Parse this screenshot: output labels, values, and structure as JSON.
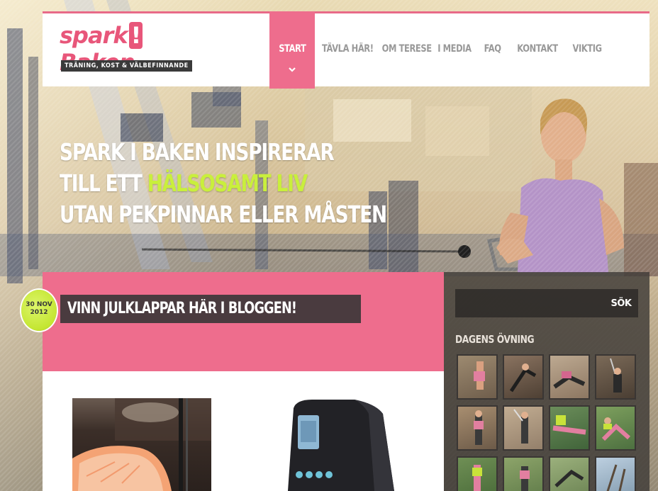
{
  "logo": {
    "brand": "spark!Baken",
    "tagline": "TRÄNING, KOST & VÄLBEFINNANDE"
  },
  "nav": {
    "items": [
      {
        "label": "START"
      },
      {
        "label": "TÄVLA HÄR!"
      },
      {
        "label": "OM TERESE"
      },
      {
        "label": "I MEDIA"
      },
      {
        "label": "FAQ"
      },
      {
        "label": "KONTAKT"
      },
      {
        "label": "VIKTIG"
      }
    ]
  },
  "hero": {
    "line1": "SPARK I BAKEN INSPIRERAR",
    "line2_pre": "TILL ETT ",
    "line2_accent": "HÄLSOSAMT LIV",
    "line3": "UTAN PEKPINNAR ELLER MÅSTEN"
  },
  "post": {
    "date_day_month": "30 NOV",
    "date_year": "2012",
    "title": "VINN JULKLAPPAR HÄR I BLOGGEN!"
  },
  "sidebar": {
    "search_button": "SÖK",
    "search_placeholder": "",
    "heading": "DAGENS ÖVNING",
    "thumbnails": [
      {
        "icon": "exercise-photo-icon"
      },
      {
        "icon": "exercise-photo-icon"
      },
      {
        "icon": "exercise-photo-icon"
      },
      {
        "icon": "exercise-photo-icon"
      },
      {
        "icon": "exercise-photo-icon"
      },
      {
        "icon": "exercise-photo-icon"
      },
      {
        "icon": "exercise-photo-icon"
      },
      {
        "icon": "exercise-photo-icon"
      },
      {
        "icon": "exercise-photo-icon"
      },
      {
        "icon": "exercise-photo-icon"
      },
      {
        "icon": "exercise-photo-icon"
      },
      {
        "icon": "exercise-photo-icon"
      }
    ]
  },
  "colors": {
    "brand_pink": "#ee6d8d",
    "accent_lime": "#c9ef3c",
    "dark": "#4a3b3f"
  }
}
